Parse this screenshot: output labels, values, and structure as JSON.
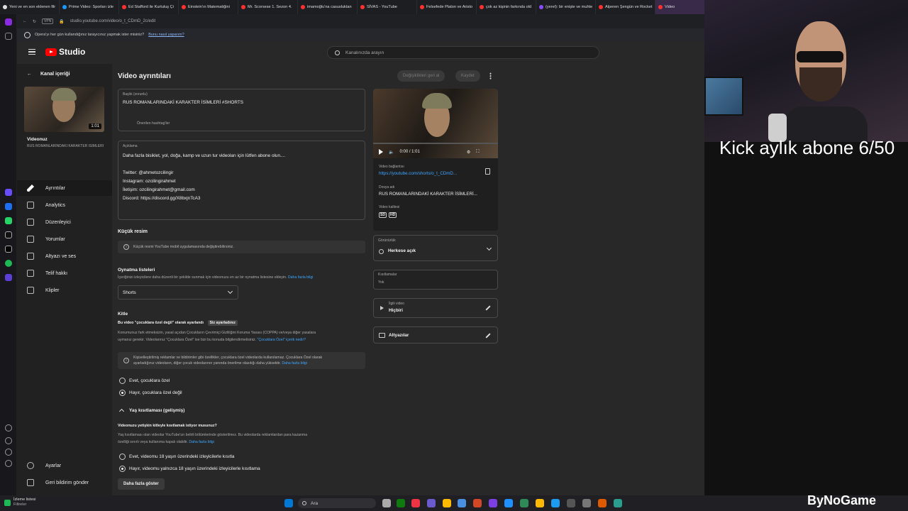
{
  "browser": {
    "tabs": [
      "Yeni ve en son eklenen filr",
      "Prime Video: Sporları izle",
      "Ed Stafford ile Kurtuluş Çi",
      "Einstein'ın Matematiğini",
      "Mr. Scorsese 1. Sezon 4.",
      "imamoğlu'na casusluktan",
      "SİVAS - YouTube",
      "Felsefede Platon ve Aristo",
      "çok az kişinin farkında old",
      "(yerel): bir enişte ve muhte",
      "Alperen Şengün ve Rocket",
      "Video"
    ],
    "tab_colors": [
      "#e0e0e0",
      "#1a98ff",
      "#ff3030",
      "#ff3030",
      "#ff3030",
      "#ff3030",
      "#ff3030",
      "#ff3030",
      "#ff3030",
      "#8a4cff",
      "#ff3030",
      "#ff3030"
    ],
    "url": "studio.youtube.com/video/o_t_CDmD_2c/edit",
    "vpn": "VPN",
    "infobar_text": "Opera'yı her gün kullandığınız tarayıcınız yapmak ister misiniz?",
    "infobar_link": "Bunu nasıl yaparım?"
  },
  "studio": {
    "logo": "Studio",
    "search_placeholder": "Kanalınızda arayın",
    "sidebar": {
      "back": "Kanal içeriği",
      "duration": "1:01",
      "video_label": "Videonuz",
      "video_title": "RUS ROMANLARINDAKİ KARAKTER İSİMLERİ",
      "items": [
        "Ayrıntılar",
        "Analytics",
        "Düzenleyici",
        "Yorumlar",
        "Altyazı ve ses",
        "Telif hakkı",
        "Klipler"
      ],
      "settings": "Ayarlar",
      "feedback": "Geri bildirim gönder"
    },
    "main": {
      "heading": "Video ayrıntıları",
      "undo": "Değişiklikleri geri al",
      "save": "Kaydet",
      "title_label": "Başlık (zorunlu)",
      "title_value": "RUS ROMANLARINDAKİ KARAKTER İSİMLERİ #SHORTS",
      "hashtags": "Önerilen hashtag'ler",
      "desc_label": "Açıklama",
      "desc_lines": [
        "Daha fazla bisiklet, yol, doğa, kamp ve uzun tur videoları için lütfen abone olun....",
        "",
        "Twitter: @ahmetozcilingir",
        "Instagram: ozcilingirahmet",
        "İletişim: ozcilingirahmet@gmail.com",
        "Discord: https://discord.gg/X8bxjnTcA3"
      ],
      "thumb_title": "Küçük resim",
      "thumb_info": "Küçük resmi YouTube mobil uygulamasında değiştirebilirsiniz.",
      "playlists_title": "Oynatma listeleri",
      "playlists_desc": "İçeriğinizi izleyicilere daha düzenli bir şekilde sunmak için videonuzu en az bir oynatma listesine ekleyin.",
      "learn_more": "Daha fazla bilgi",
      "playlist_value": "Shorts",
      "audience_title": "Kitle",
      "audience_set": "Bu video \"çocuklara özel değil\" olarak ayarlandı",
      "audience_badge": "Siz ayarladınız",
      "audience_desc1": "Konumunuz fark etmeksizin, yasal açıdan Çocukların Çevrimiçi Gizliliğini Koruma Yasası (COPPA) ve/veya diğer yasalara",
      "audience_desc2": "uymanız gerekir. Videolarınız \"Çocuklara Özel\" ise bizi bu konuda bilgilendirmelisiniz.",
      "audience_link": "\"Çocuklara Özel\" içerik nedir?",
      "audience_info1": "Kişiselleştirilmiş reklamlar ve bildirimler gibi özellikler, çocuklara özel videolarda kullanılamaz. Çocuklara Özel olarak",
      "audience_info2": "ayarladığınız videoların, diğer çocuk videolarının yanında önerilme olasılığı daha yüksektir.",
      "radio_kids_yes": "Evet, çocuklara özel",
      "radio_kids_no": "Hayır, çocuklara özel değil",
      "age_title": "Yaş kısıtlaması (gelişmiş)",
      "age_question": "Videonuzu yetişkin kitleyle kısıtlamak istiyor musunuz?",
      "age_desc1": "Yaş kısıtlaması olan videolar YouTube'un belirli bölümlerinde gösterilmez. Bu videolarda reklamlardan para kazanma",
      "age_desc2": "özelliği sınırlı veya kullanıma kapalı olabilir.",
      "radio_age_yes": "Evet, videomu 18 yaşın üzerindeki izleyicilerle kısıtla",
      "radio_age_no": "Hayır, videomu yalnızca 18 yaşın üzerindeki izleyicilerle kısıtlama",
      "show_more": "Daha fazla göster"
    },
    "right": {
      "time": "0:00 / 1:01",
      "link_label": "Video bağlantısı",
      "link": "https://youtube.com/shorts/o_t_CDmD...",
      "file_label": "Dosya adı",
      "file": "RUS ROMANLARINDAKİ KARAKTER İSİMLERİ...",
      "quality_label": "Video kalitesi",
      "q_sd": "SD",
      "q_hd": "HD",
      "visibility_label": "Görünürlük",
      "visibility": "Herkese açık",
      "restrictions_label": "Kısıtlamalar",
      "restrictions": "Yok",
      "related_label": "İlgili video",
      "related": "Hiçbiri",
      "subtitles": "Altyazılar"
    }
  },
  "overlay": {
    "kick": "Kick aylık abone 6/50",
    "brand": "ByNoGame"
  },
  "taskbar": {
    "watchlist": "İzleme listesi",
    "watchlist_sub": "Filtreler",
    "search": "Ara",
    "colors": [
      "#0078d4",
      "#555",
      "#aaa",
      "#0f7b0f",
      "#e34",
      "#6a5acd",
      "#fcb900",
      "#4a90e2",
      "#d24726",
      "#7b3fe4",
      "#1e90ff",
      "#2e8b57",
      "#ffb900",
      "#1d9bf0",
      "#555",
      "#777",
      "#e05a00",
      "#2a9d8f"
    ]
  }
}
